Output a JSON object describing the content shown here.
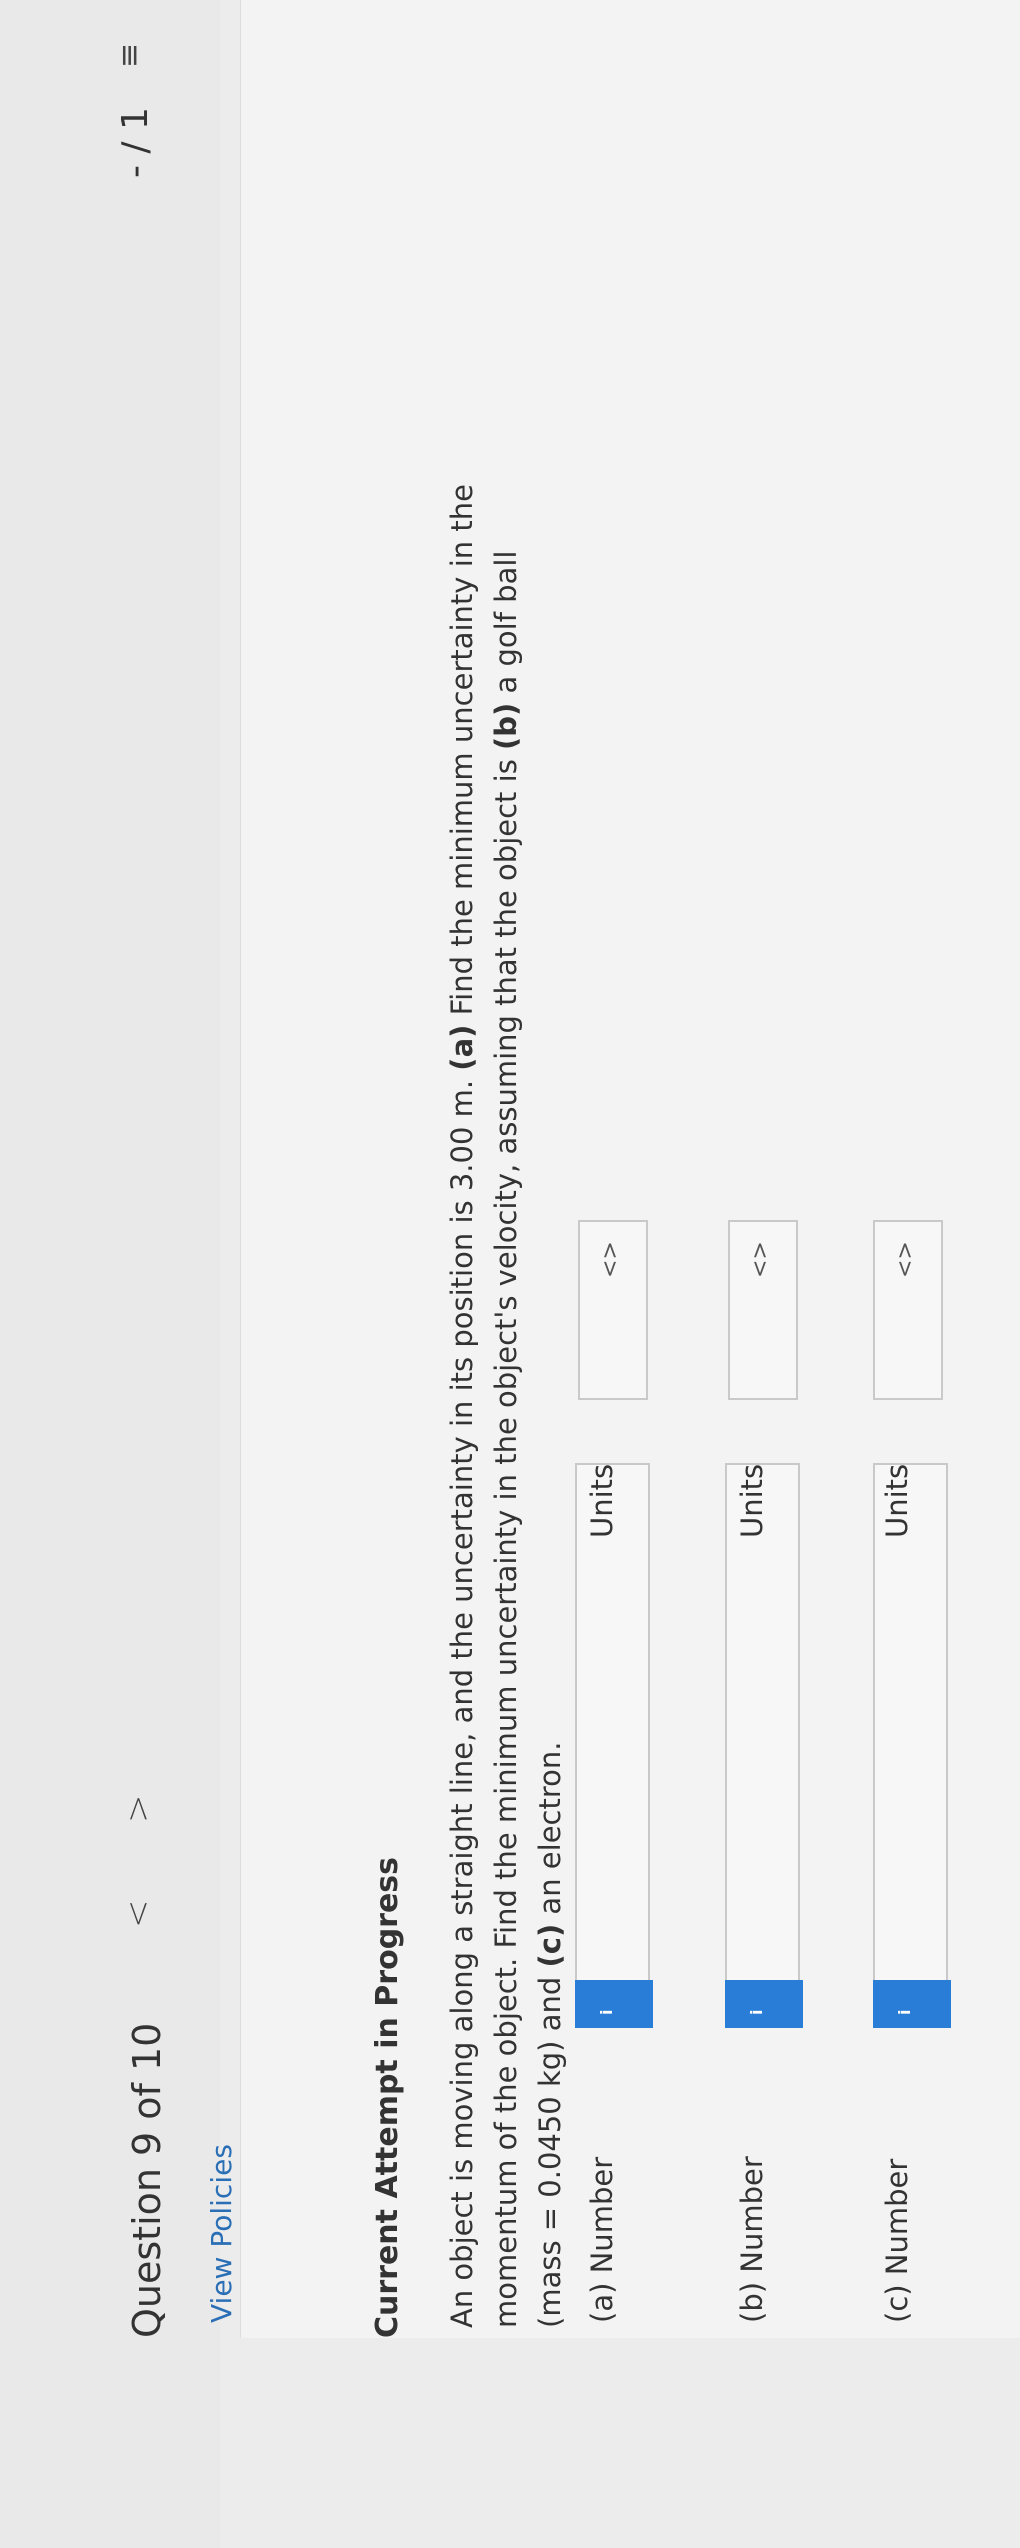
{
  "header": {
    "question_title": "Question 9 of 10",
    "prev_label": "<",
    "next_label": ">",
    "score": "- / 1",
    "list_icon": "list-icon",
    "more_icon": "more-icon"
  },
  "links": {
    "view_policies": "View Policies"
  },
  "status": {
    "attempt": "Current Attempt in Progress"
  },
  "question": {
    "line1_a": "An object is moving along a straight line, and the uncertainty in its position is 3.00 m. ",
    "line1_b": "(a)",
    "line1_c": " Find the minimum uncertainty in the",
    "line2_a": "momentum of the object. Find the minimum uncertainty in the object's velocity, assuming that the object is ",
    "line2_b": "(b)",
    "line2_c": " a golf ball",
    "line3_a": "(mass = 0.0450 kg) and ",
    "line3_b": "(c)",
    "line3_c": " an electron."
  },
  "parts": [
    {
      "label": "(a)   Number",
      "units_label": "Units",
      "units_glyph": "<>"
    },
    {
      "label": "(b)   Number",
      "units_label": "Units",
      "units_glyph": "<>"
    },
    {
      "label": "(c)   Number",
      "units_label": "Units",
      "units_glyph": "<>"
    }
  ],
  "info_glyph": "i"
}
